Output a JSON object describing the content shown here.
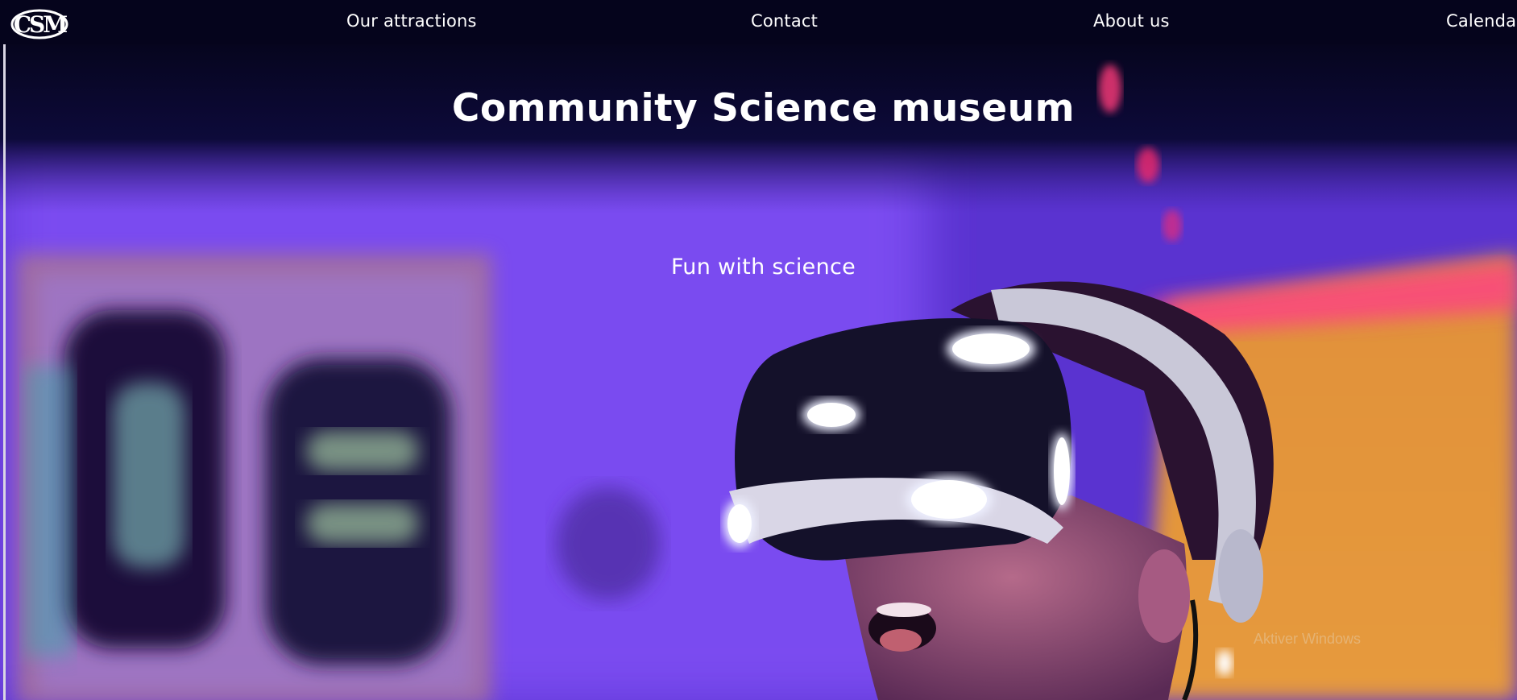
{
  "header": {
    "logo_text": "CSM",
    "nav": [
      {
        "label": "Our attractions"
      },
      {
        "label": "Contact"
      },
      {
        "label": "About us"
      },
      {
        "label": "Calenda"
      }
    ]
  },
  "hero": {
    "title": "Community Science museum",
    "subtitle": "Fun with science",
    "image_icon": "vr-headset-photo"
  },
  "os_overlay": {
    "watermark": "Aktiver Windows"
  },
  "colors": {
    "nav_bg": "#05041c",
    "text": "#ffffff",
    "hero_purple": "#6d3de8",
    "hero_orange": "#f0a040",
    "headset_glow": "#d8dcff"
  }
}
